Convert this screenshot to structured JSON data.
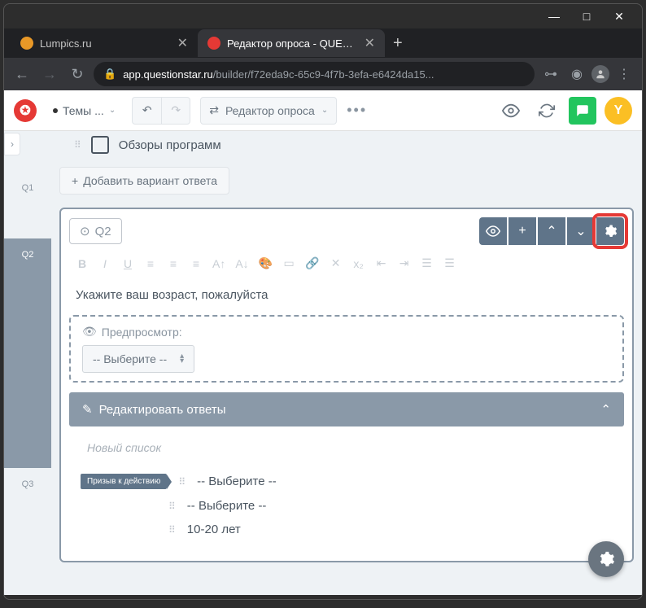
{
  "window": {
    "min": "—",
    "max": "□",
    "close": "✕"
  },
  "tabs": {
    "t1": "Lumpics.ru",
    "t2": "Редактор опроса - QUESTIONST",
    "close": "✕",
    "new": "+"
  },
  "nav": {
    "back": "←",
    "fwd": "→",
    "reload": "↻"
  },
  "url": {
    "domain": "app.questionstar.ru",
    "path": "/builder/f72eda9c-65c9-4f7b-3efa-e6424da15..."
  },
  "header": {
    "themes": "Темы ...",
    "editor": "Редактор опроса",
    "avatar": "Y"
  },
  "q1": {
    "option": "Обзоры программ",
    "add": "Добавить вариант ответа"
  },
  "q2": {
    "label": "Q2",
    "title": "Укажите ваш возраст, пожалуйста",
    "preview": "Предпросмотр:",
    "select": "-- Выберите --",
    "editans": "Редактировать ответы",
    "newlist": "Новый список",
    "cta": "Призыв к действию"
  },
  "answers": {
    "a1": "-- Выберите --",
    "a2": "-- Выберите --",
    "a3": "10-20 лет"
  },
  "side": {
    "q1": "Q1",
    "q2": "Q2",
    "q3": "Q3"
  }
}
